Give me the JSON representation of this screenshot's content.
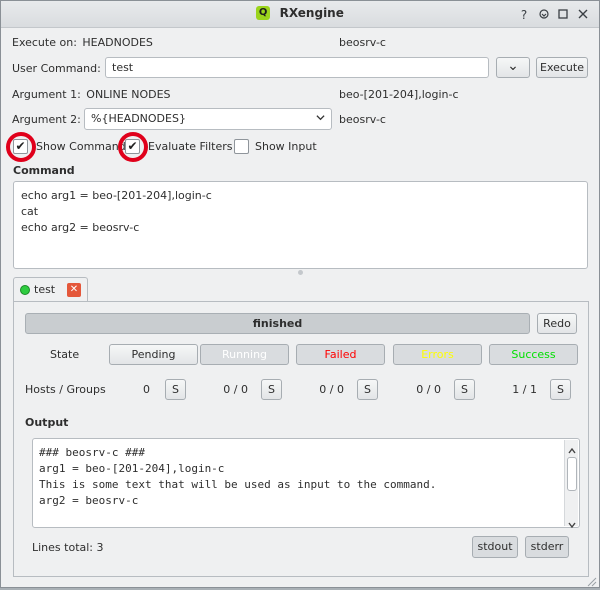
{
  "window": {
    "title": "RXengine",
    "app_icon_letter": "Q"
  },
  "execute_on": {
    "label": "Execute on:",
    "value": "HEADNODES",
    "result": "beosrv-c"
  },
  "user_command": {
    "label": "User Command:",
    "value": "test",
    "dropdown_glyph": "⌄",
    "execute_label": "Execute"
  },
  "argument1": {
    "label": "Argument 1:",
    "value": "ONLINE NODES",
    "result": "beo-[201-204],login-c"
  },
  "argument2": {
    "label": "Argument 2:",
    "value": "%{HEADNODES}",
    "result": "beosrv-c"
  },
  "options": {
    "show_command": "Show Command",
    "evaluate_filters": "Evaluate Filters",
    "show_input": "Show Input"
  },
  "command": {
    "title": "Command",
    "lines": [
      "echo arg1 = beo-[201-204],login-c",
      "cat",
      "echo arg2 = beosrv-c"
    ]
  },
  "tab": {
    "label": "test",
    "status_color": "#2ecc40"
  },
  "progress": {
    "label": "finished",
    "redo_label": "Redo"
  },
  "states": {
    "label": "State",
    "items": [
      {
        "label": "Pending",
        "color": "#2e2e2e"
      },
      {
        "label": "Running",
        "color": "#ffffff"
      },
      {
        "label": "Failed",
        "color": "#ff0000"
      },
      {
        "label": "Errors",
        "color": "#ffff00"
      },
      {
        "label": "Success",
        "color": "#00e000"
      }
    ]
  },
  "hosts": {
    "label": "Hosts / Groups",
    "button_label": "S",
    "counts": [
      "0",
      "0 / 0",
      "0 / 0",
      "0 / 0",
      "1 / 1"
    ]
  },
  "output": {
    "title": "Output",
    "lines": [
      "### beosrv-c ###",
      "arg1 = beo-[201-204],login-c",
      "This is some text that will be used as input to the command.",
      "arg2 = beosrv-c"
    ],
    "lines_total": "Lines total: 3",
    "stdout_label": "stdout",
    "stderr_label": "stderr"
  }
}
